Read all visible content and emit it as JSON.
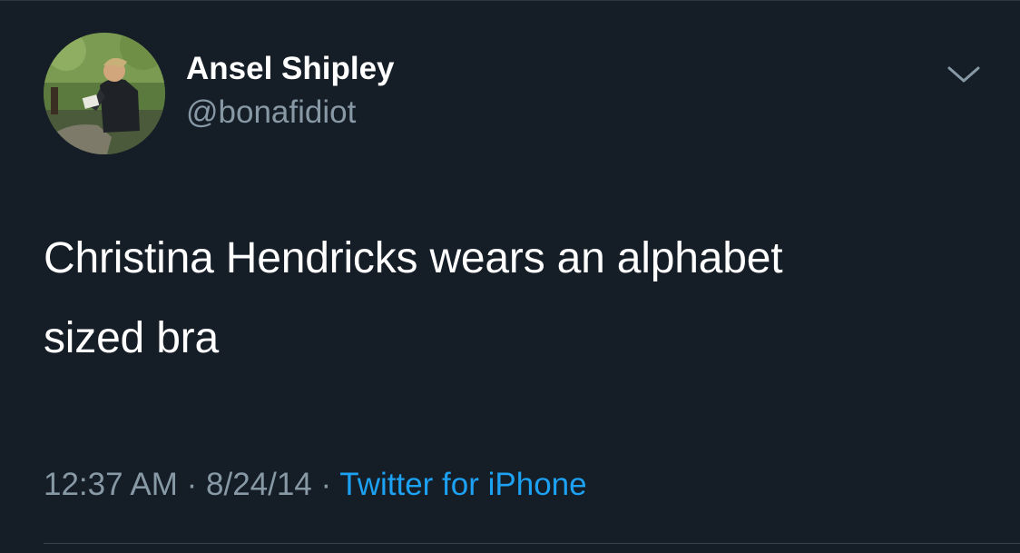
{
  "user": {
    "display_name": "Ansel Shipley",
    "handle": "@bonafidiot",
    "avatar_icon": "profile-photo"
  },
  "tweet": {
    "line1": "Christina Hendricks wears an alphabet",
    "line2": "sized bra"
  },
  "meta": {
    "time": "12:37 AM",
    "separator": " · ",
    "date": "8/24/14",
    "source": "Twitter for iPhone"
  },
  "menu_icon": "chevron-down-icon",
  "colors": {
    "background": "#151d27",
    "primary_text": "#ffffff",
    "secondary_text": "#8899a6",
    "link": "#1da1f2",
    "divider": "#38444d"
  }
}
